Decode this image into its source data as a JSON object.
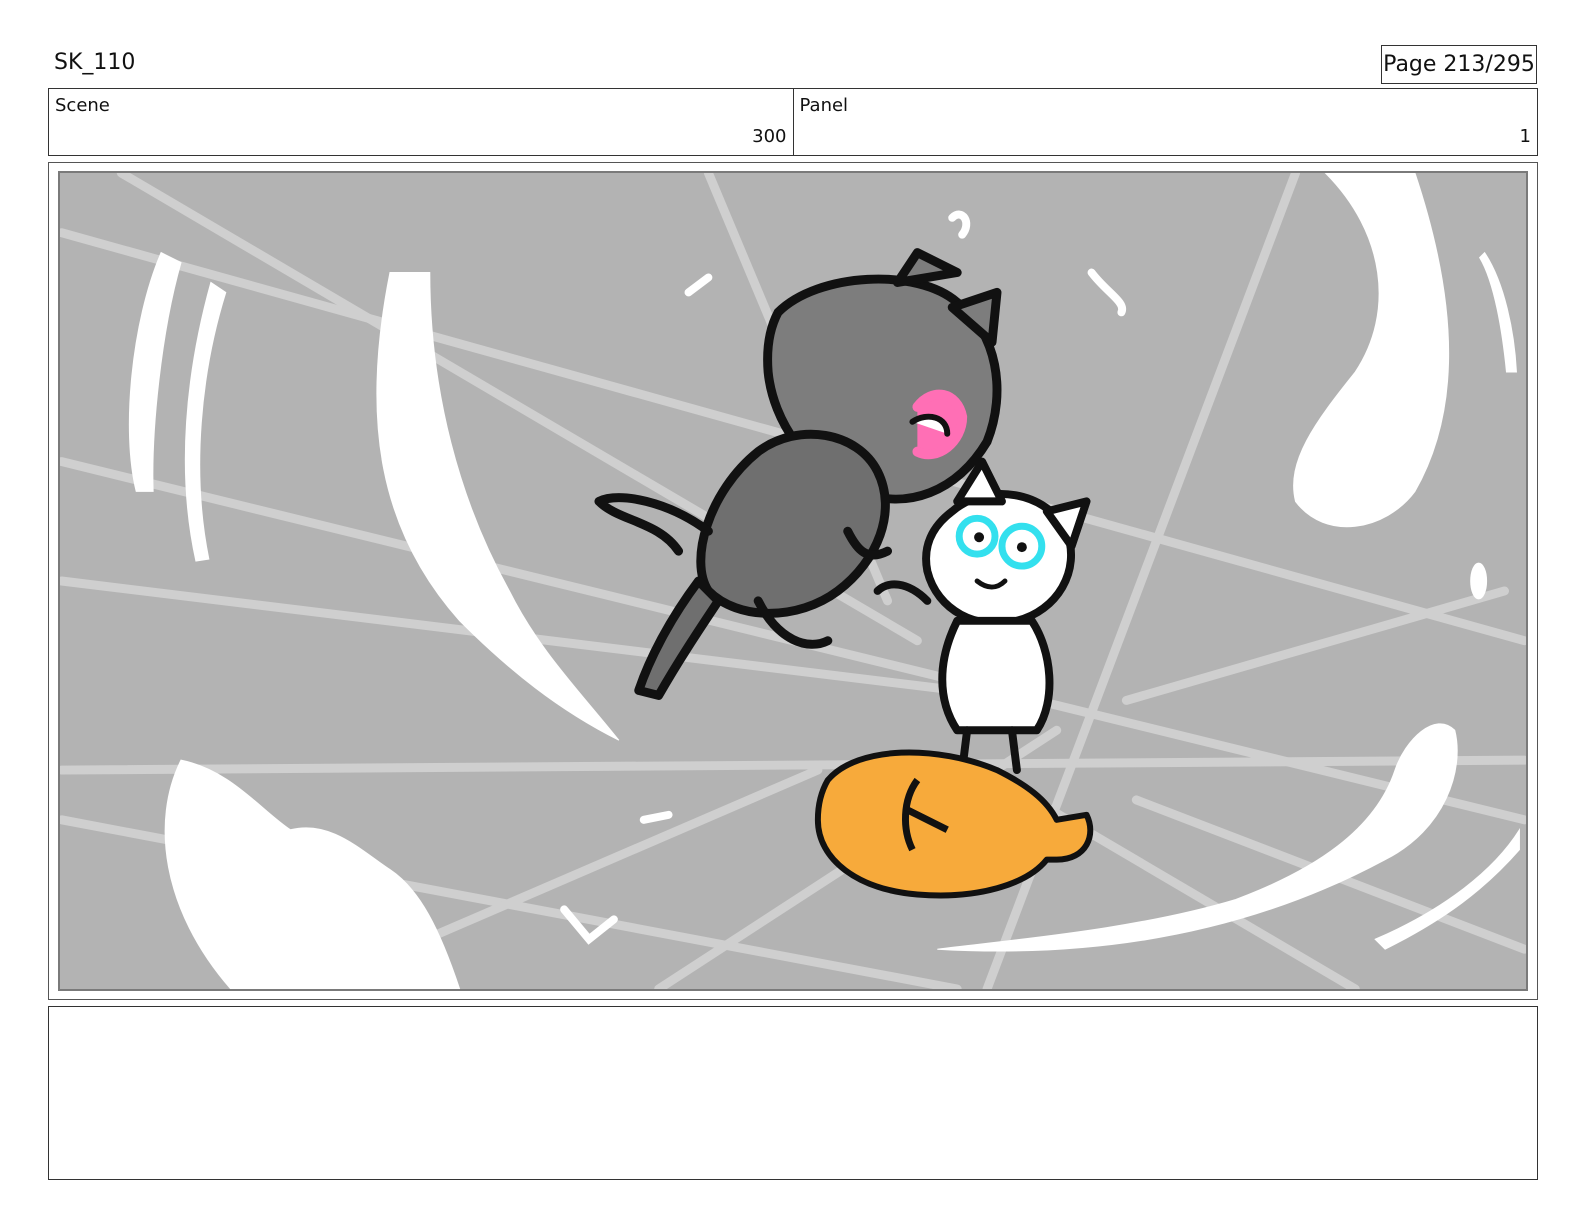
{
  "header": {
    "doc_id": "SK_110",
    "page_label": "Page 213/295"
  },
  "info": {
    "scene_label": "Scene",
    "scene_value": "300",
    "panel_label": "Panel",
    "panel_value": "1"
  },
  "panel": {
    "background_color": "#b3b3b3",
    "line_color": "#cfcfcf",
    "accent_pink": "#ff6fb5",
    "accent_cyan": "#33e0ee",
    "accent_orange": "#f7aa3b"
  },
  "notes": {
    "text": ""
  }
}
